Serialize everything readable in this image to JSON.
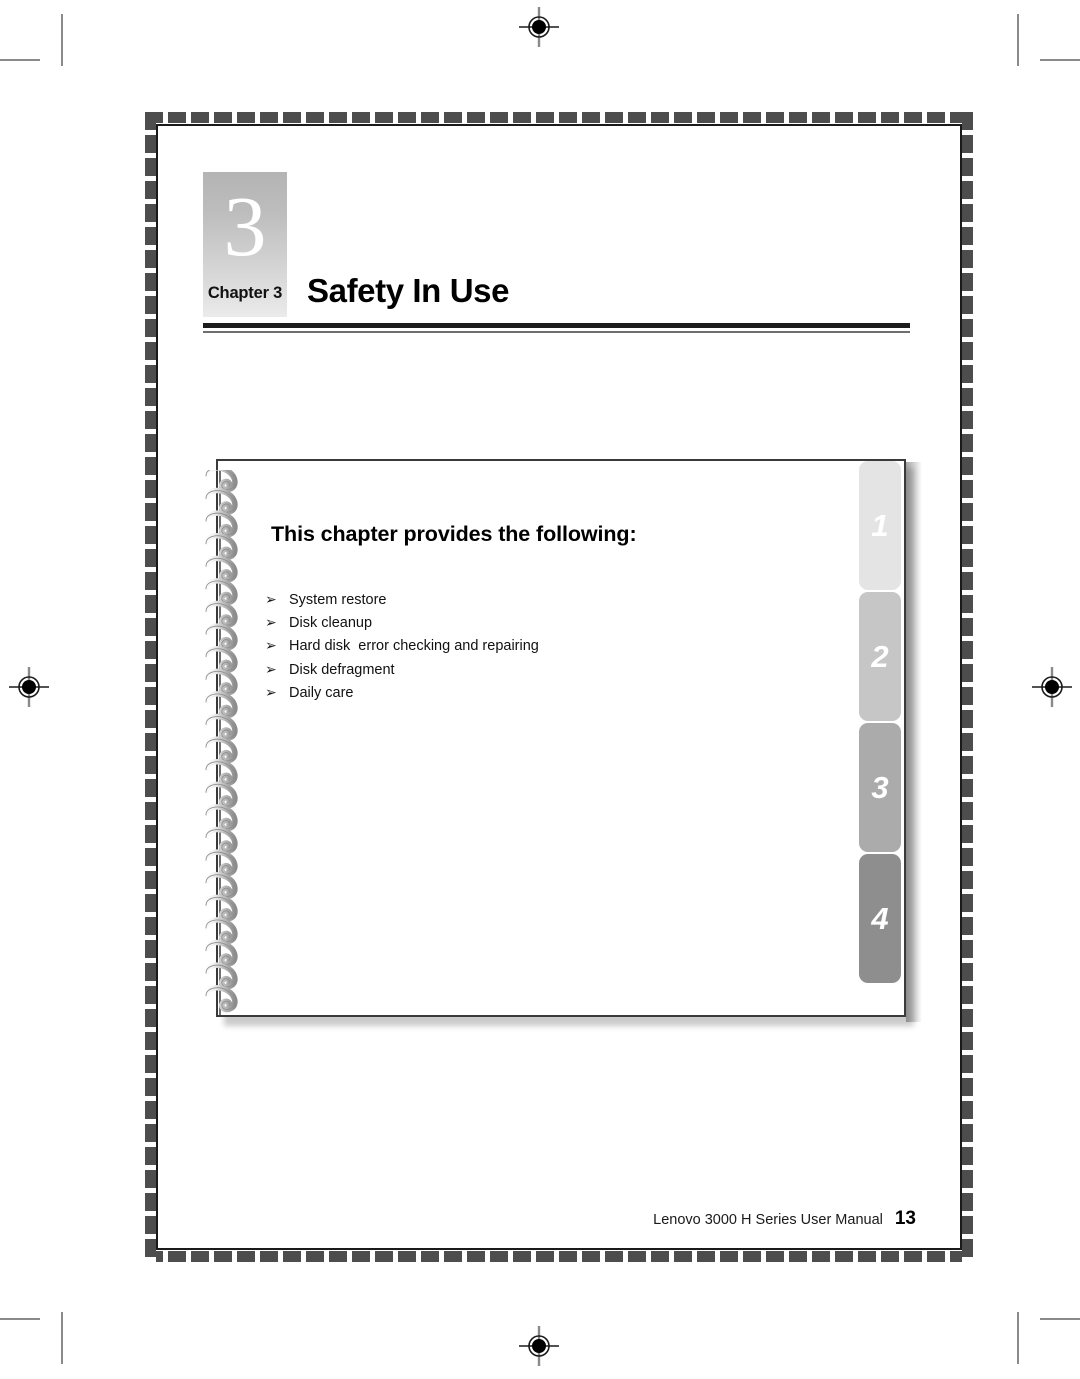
{
  "document": {
    "type": "user-manual-page",
    "page_number": "13"
  },
  "crop_marks": {
    "registration_icon": "registration-crosshair-icon",
    "positions": [
      "top-center",
      "bottom-center",
      "left-middle",
      "right-middle"
    ],
    "corner_marks": [
      "top-left",
      "top-right",
      "bottom-left",
      "bottom-right"
    ]
  },
  "chapter": {
    "big_number": "3",
    "label": "Chapter 3",
    "title": "Safety In Use"
  },
  "card": {
    "heading": "This chapter provides the following:",
    "bullet_glyph": "➢",
    "items": [
      "System restore",
      "Disk cleanup",
      "Hard disk  error checking and repairing",
      "Disk defragment",
      "Daily care"
    ]
  },
  "tabs": [
    {
      "label": "1",
      "color": "#e4e4e4"
    },
    {
      "label": "2",
      "color": "#c6c6c6"
    },
    {
      "label": "3",
      "color": "#ababab"
    },
    {
      "label": "4",
      "color": "#8e8e8e"
    }
  ],
  "footer": {
    "text": "Lenovo 3000 H Series User Manual",
    "page": "13"
  },
  "colors": {
    "frame_dash": "#4d4d4d",
    "page_border": "#1a1a1a",
    "rule": "#1c1c1c",
    "tab_backstrip": "#000000"
  }
}
